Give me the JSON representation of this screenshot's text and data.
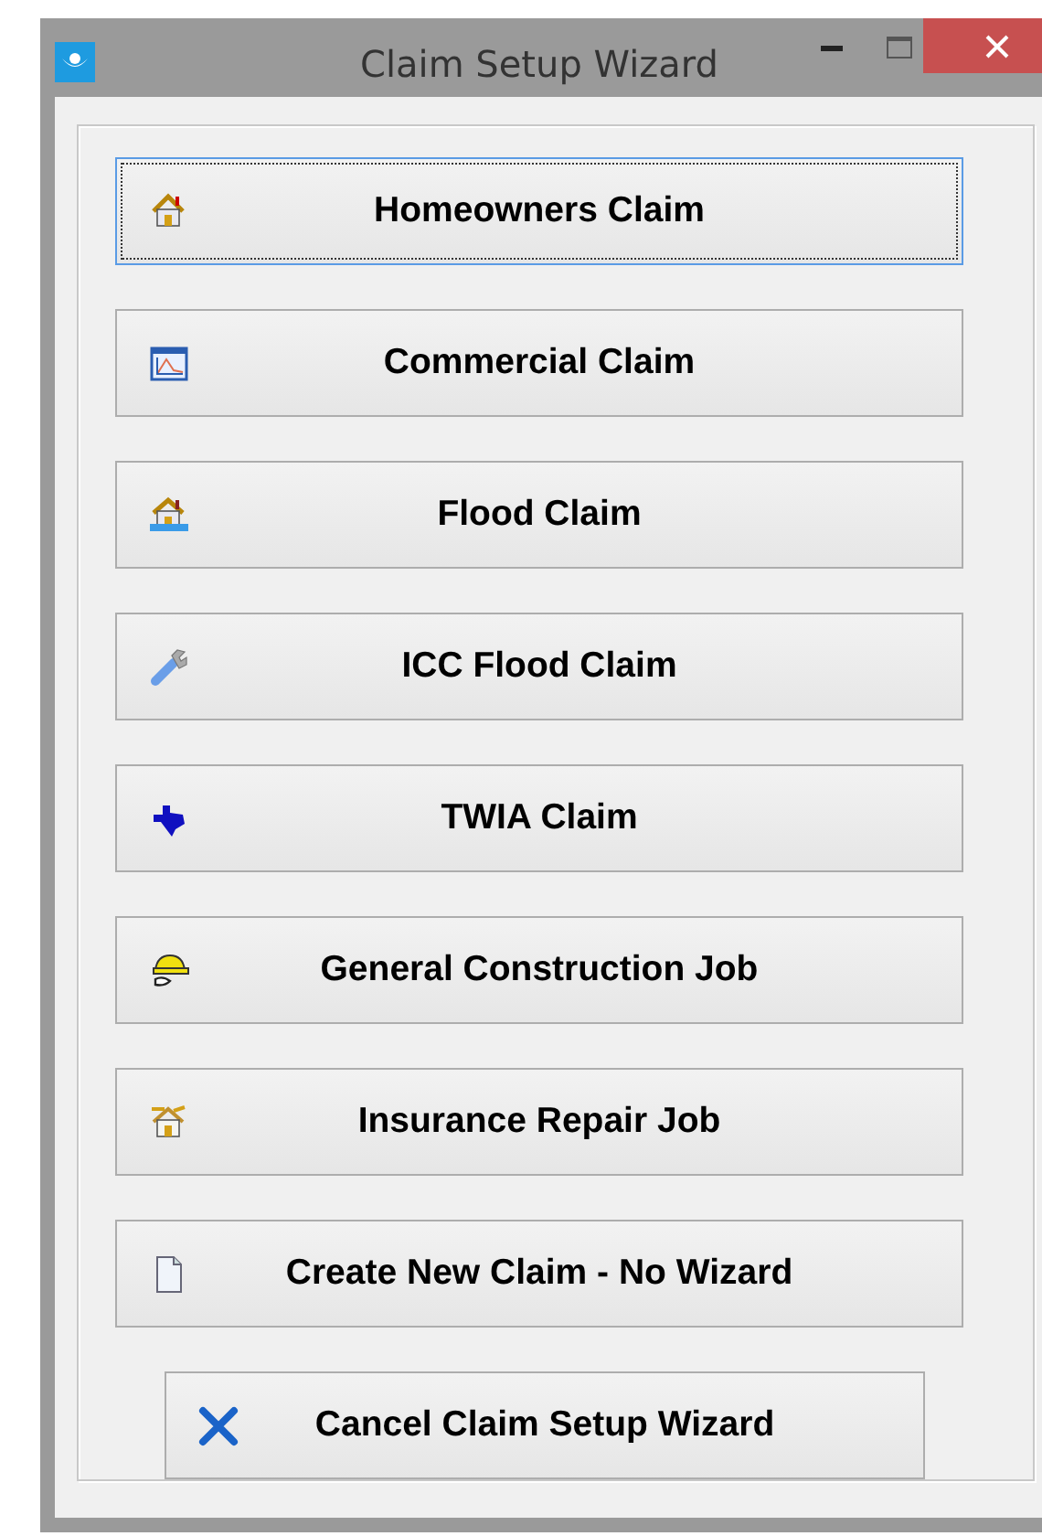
{
  "window": {
    "title": "Claim Setup Wizard"
  },
  "options": [
    {
      "label": "Homeowners Claim",
      "kind": "house",
      "focused": true
    },
    {
      "label": "Commercial Claim",
      "kind": "chart",
      "focused": false
    },
    {
      "label": "Flood Claim",
      "kind": "flood",
      "focused": false
    },
    {
      "label": "ICC Flood Claim",
      "kind": "wrench",
      "focused": false
    },
    {
      "label": "TWIA Claim",
      "kind": "texas",
      "focused": false
    },
    {
      "label": "General Construction Job",
      "kind": "hardhat",
      "focused": false
    },
    {
      "label": "Insurance Repair Job",
      "kind": "repair",
      "focused": false
    },
    {
      "label": "Create New Claim - No Wizard",
      "kind": "document",
      "focused": false
    }
  ],
  "cancel_button": {
    "label": "Cancel Claim Setup Wizard"
  }
}
